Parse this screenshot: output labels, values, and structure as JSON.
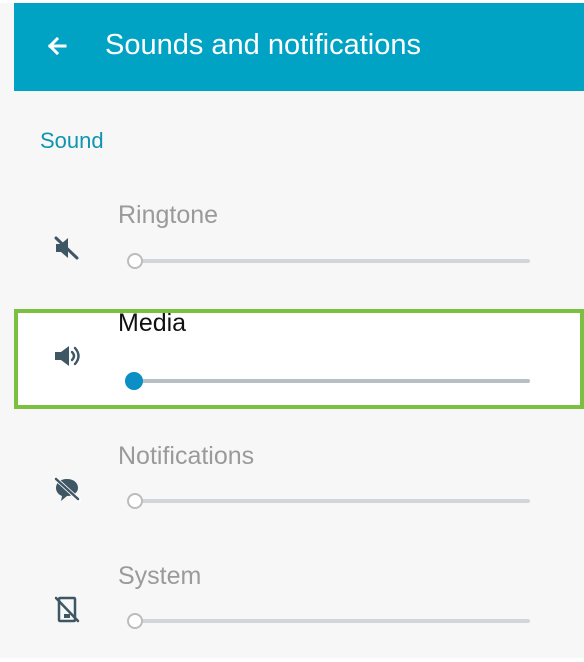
{
  "header": {
    "title": "Sounds and notifications",
    "back_icon": "arrow-left-icon",
    "background_color": "#00a3c4"
  },
  "section": {
    "label": "Sound",
    "label_color": "#0f95b0"
  },
  "settings": [
    {
      "label": "Ringtone",
      "icon": "muted-speaker-icon",
      "level": 0,
      "active": false
    },
    {
      "label": "Media",
      "icon": "speaker-icon",
      "level": 0,
      "active": true
    },
    {
      "label": "Notifications",
      "icon": "notifications-off-icon",
      "level": 0,
      "active": false
    },
    {
      "label": "System",
      "icon": "system-sound-off-icon",
      "level": 0,
      "active": false
    }
  ],
  "colors": {
    "highlight_outline": "#7cc03f",
    "active_slider": "#0b8fc4",
    "inactive_text": "#9a9a9a",
    "active_text": "#111111"
  }
}
